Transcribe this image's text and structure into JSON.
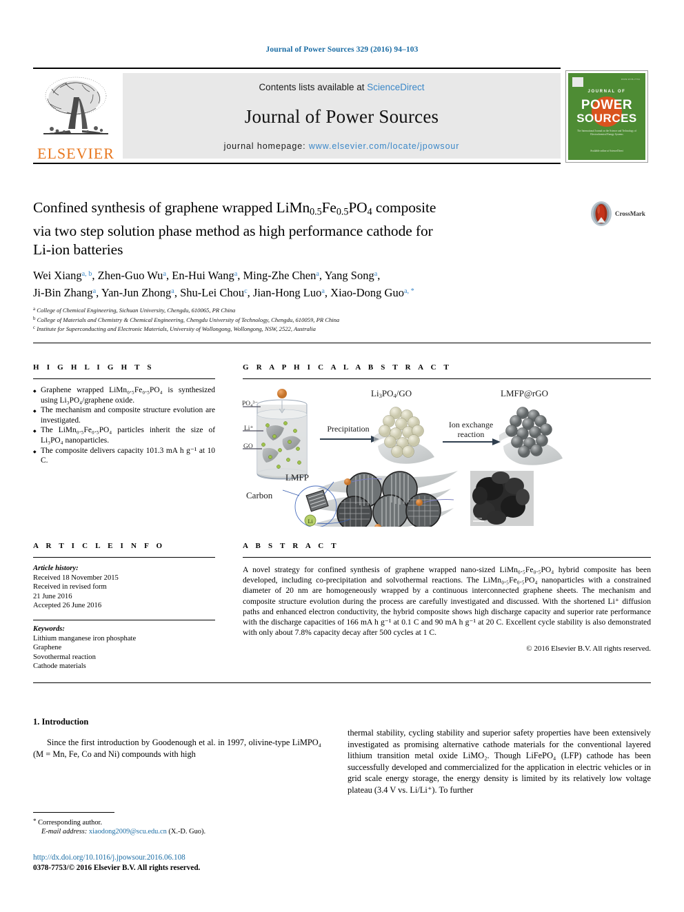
{
  "header": {
    "journal_reference": "Journal of Power Sources 329 (2016) 94–103"
  },
  "masthead": {
    "contents_prefix": "Contents lists available at ",
    "sciencedirect": "ScienceDirect",
    "journal_name": "Journal of Power Sources",
    "homepage_prefix": "journal homepage: ",
    "homepage_url": "www.elsevier.com/locate/jpowsour",
    "publisher": "ELSEVIER",
    "cover": {
      "journal_of": "JOURNAL OF",
      "power": "POWER",
      "sources": "SOURCES",
      "blurb": "The International Journal on the Science and Technology of Electrochemical Energy Systems",
      "footer": "Available online at\nScienceDirect"
    },
    "accent_blue": "#3a87c8",
    "elsevier_orange": "#e8771e",
    "cover_green": "#4e8c34"
  },
  "article": {
    "title_line1": "Confined synthesis of graphene wrapped LiMn",
    "title_sub1": "0.5",
    "title_mid1": "Fe",
    "title_sub2": "0.5",
    "title_mid2": "PO",
    "title_sub3": "4",
    "title_end1": " composite",
    "title_line2": "via two step solution phase method as high performance cathode for",
    "title_line3": "Li-ion batteries",
    "crossmark_label": "CrossMark",
    "authors": [
      {
        "name": "Wei Xiang",
        "sup": "a, b"
      },
      {
        "name": "Zhen-Guo Wu",
        "sup": "a"
      },
      {
        "name": "En-Hui Wang",
        "sup": "a"
      },
      {
        "name": "Ming-Zhe Chen",
        "sup": "a"
      },
      {
        "name": "Yang Song",
        "sup": "a"
      },
      {
        "name": "Ji-Bin Zhang",
        "sup": "a"
      },
      {
        "name": "Yan-Jun Zhong",
        "sup": "a"
      },
      {
        "name": "Shu-Lei Chou",
        "sup": "c"
      },
      {
        "name": "Jian-Hong Luo",
        "sup": "a"
      },
      {
        "name": "Xiao-Dong Guo",
        "sup": "a, *"
      }
    ],
    "affiliations": [
      {
        "mark": "a",
        "text": "College of Chemical Engineering, Sichuan University, Chengdu, 610065, PR China"
      },
      {
        "mark": "b",
        "text": "College of Materials and Chemistry & Chemical Engineering, Chengdu University of Technology, Chengdu, 610059, PR China"
      },
      {
        "mark": "c",
        "text": "Institute for Superconducting and Electronic Materials, University of Wollongong, Wollongong, NSW, 2522, Australia"
      }
    ]
  },
  "highlights": {
    "heading": "H I G H L I G H T S",
    "items": [
      "Graphene wrapped LiMn₀.₅Fe₀.₅PO₄ is synthesized using Li₃PO₄/graphene oxide.",
      "The mechanism and composite structure evolution are investigated.",
      "The LiMn₀.₅Fe₀.₅PO₄ particles inherit the size of Li₃PO₄ nanoparticles.",
      "The composite delivers capacity 101.3 mA h g⁻¹ at 10 C."
    ]
  },
  "graphical_abstract": {
    "heading": "G R A P H I C A L   A B S T R A C T",
    "labels": {
      "po4": "PO₄³⁻",
      "li": "Li⁺",
      "go": "GO",
      "precipitation": "Precipitation",
      "li3po4_go": "Li₃PO₄/GO",
      "ion_exchange_l1": "Ion exchange",
      "ion_exchange_l2": "reaction",
      "lmfp_rgo": "LMFP@rGO",
      "lmfp": "LMFP",
      "carbon": "Carbon",
      "li_particle": "Li"
    }
  },
  "article_info": {
    "heading": "A R T I C L E   I N F O",
    "history_label": "Article history:",
    "history": [
      "Received 18 November 2015",
      "Received in revised form",
      "21 June 2016",
      "Accepted 26 June 2016"
    ],
    "keywords_label": "Keywords:",
    "keywords": [
      "Lithium manganese iron phosphate",
      "Graphene",
      "Sovothermal reaction",
      "Cathode materials"
    ]
  },
  "abstract": {
    "heading": "A B S T R A C T",
    "text": "A novel strategy for confined synthesis of graphene wrapped nano-sized LiMn₀.₅Fe₀.₅PO₄ hybrid composite has been developed, including co-precipitation and solvothermal reactions. The LiMn₀.₅Fe₀.₅PO₄ nanoparticles with a constrained diameter of 20 nm are homogeneously wrapped by a continuous interconnected graphene sheets. The mechanism and composite structure evolution during the process are carefully investigated and discussed. With the shortened Li⁺ diffusion paths and enhanced electron conductivity, the hybrid composite shows high discharge capacity and superior rate performance with the discharge capacities of 166 mA h g⁻¹ at 0.1 C and 90 mA h g⁻¹ at 20 C. Excellent cycle stability is also demonstrated with only about 7.8% capacity decay after 500 cycles at 1 C.",
    "copyright": "© 2016 Elsevier B.V. All rights reserved."
  },
  "body": {
    "section_title": "1. Introduction",
    "left_paragraph": "Since the first introduction by Goodenough et al. in 1997, olivine-type LiMPO₄ (M = Mn, Fe, Co and Ni) compounds with high",
    "right_paragraph": "thermal stability, cycling stability and superior safety properties have been extensively investigated as promising alternative cathode materials for the conventional layered lithium transition metal oxide LiMO₂. Though LiFePO₄ (LFP) cathode has been successfully developed and commercialized for the application in electric vehicles or in grid scale energy storage, the energy density is limited by its relatively low voltage plateau (3.4 V vs. Li/Li⁺). To further"
  },
  "footnote": {
    "corresponding": "Corresponding author.",
    "email_label": "E-mail address:",
    "email": "xiaodong2009@scu.edu.cn",
    "email_owner": "(X.-D. Guo).",
    "doi": "http://dx.doi.org/10.1016/j.jpowsour.2016.06.108",
    "issn": "0378-7753/© 2016 Elsevier B.V. All rights reserved."
  }
}
